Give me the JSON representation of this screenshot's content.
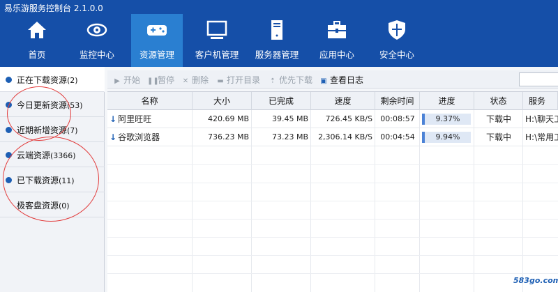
{
  "app": {
    "title": "易乐游服务控制台 2.1.0.0"
  },
  "nav": {
    "items": [
      {
        "label": "首页",
        "icon": "home-icon"
      },
      {
        "label": "监控中心",
        "icon": "eye-icon"
      },
      {
        "label": "资源管理",
        "icon": "gamepad-icon",
        "active": true
      },
      {
        "label": "客户机管理",
        "icon": "monitor-icon"
      },
      {
        "label": "服务器管理",
        "icon": "server-icon"
      },
      {
        "label": "应用中心",
        "icon": "briefcase-icon"
      },
      {
        "label": "安全中心",
        "icon": "shield-icon"
      }
    ]
  },
  "sidebar": {
    "items": [
      {
        "label": "正在下载资源",
        "count": "(2)",
        "active": true
      },
      {
        "label": "今日更新资源",
        "count": "(53)"
      },
      {
        "label": "近期新增资源",
        "count": "(7)"
      },
      {
        "label": "云端资源",
        "count": "(3366)"
      },
      {
        "label": "已下载资源",
        "count": "(11)"
      },
      {
        "label": "极客盘资源",
        "count": "(0)"
      }
    ]
  },
  "toolbar": {
    "start": "开始",
    "pause": "暂停",
    "delete": "删除",
    "open_dir": "打开目录",
    "priority": "优先下载",
    "view_log": "查看日志"
  },
  "table": {
    "columns": [
      "名称",
      "大小",
      "已完成",
      "速度",
      "剩余时间",
      "进度",
      "状态",
      "服务"
    ],
    "rows": [
      {
        "name": "阿里旺旺",
        "size": "420.69 MB",
        "done": "39.45 MB",
        "speed": "726.45 KB/S",
        "remaining": "00:08:57",
        "progress_text": "9.37%",
        "progress": 0.0937,
        "status": "下载中",
        "server_path": "H:\\聊天工"
      },
      {
        "name": "谷歌浏览器",
        "size": "736.23 MB",
        "done": "73.23 MB",
        "speed": "2,306.14 KB/S",
        "remaining": "00:04:54",
        "progress_text": "9.94%",
        "progress": 0.0994,
        "status": "下载中",
        "server_path": "H:\\常用工"
      }
    ]
  },
  "watermark": "583go.com",
  "colors": {
    "header_bg": "#154fa8",
    "active_tab": "#2a7fd1",
    "accent": "#1d5fb4",
    "annotation_circle": "#e23b3b"
  }
}
